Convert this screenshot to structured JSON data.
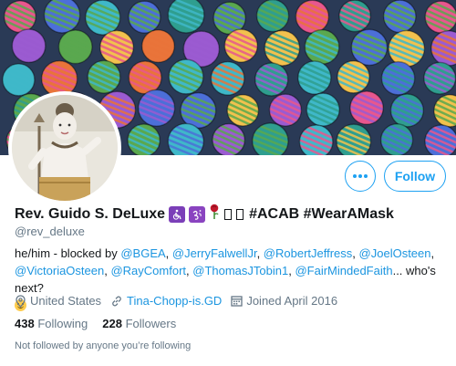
{
  "profile": {
    "display_name": "Rev. Guido S. DeLuxe",
    "name_tags": "#ACAB #WearAMask",
    "handle": "@rev_deluxe",
    "bio": {
      "prefix": "he/him - blocked by ",
      "mentions": [
        "@BGEA",
        "@JerryFalwellJr",
        "@RobertJeffress",
        "@JoelOsteen",
        "@VictoriaOsteen",
        "@RayComfort",
        "@ThomasJTobin1",
        "@FairMindedFaith"
      ],
      "separator": ", ",
      "suffix": "... who's next?"
    },
    "location": "United States",
    "website": "Tina-Chopp-is.GD",
    "joined": "Joined April 2016",
    "following_count": "438",
    "following_label": "Following",
    "followers_count": "228",
    "followers_label": "Followers",
    "followed_by_note": "Not followed by anyone you’re following"
  },
  "actions": {
    "follow_label": "Follow",
    "more_icon": "ellipsis-icon"
  },
  "name_emoji": [
    "wheelchair-icon",
    "om-icon",
    "rose-icon",
    "unsupported-glyph",
    "unsupported-glyph"
  ],
  "colors": {
    "accent": "#1da1f2",
    "link": "#1b95e0",
    "text_primary": "#14171a",
    "text_secondary": "#657786"
  }
}
